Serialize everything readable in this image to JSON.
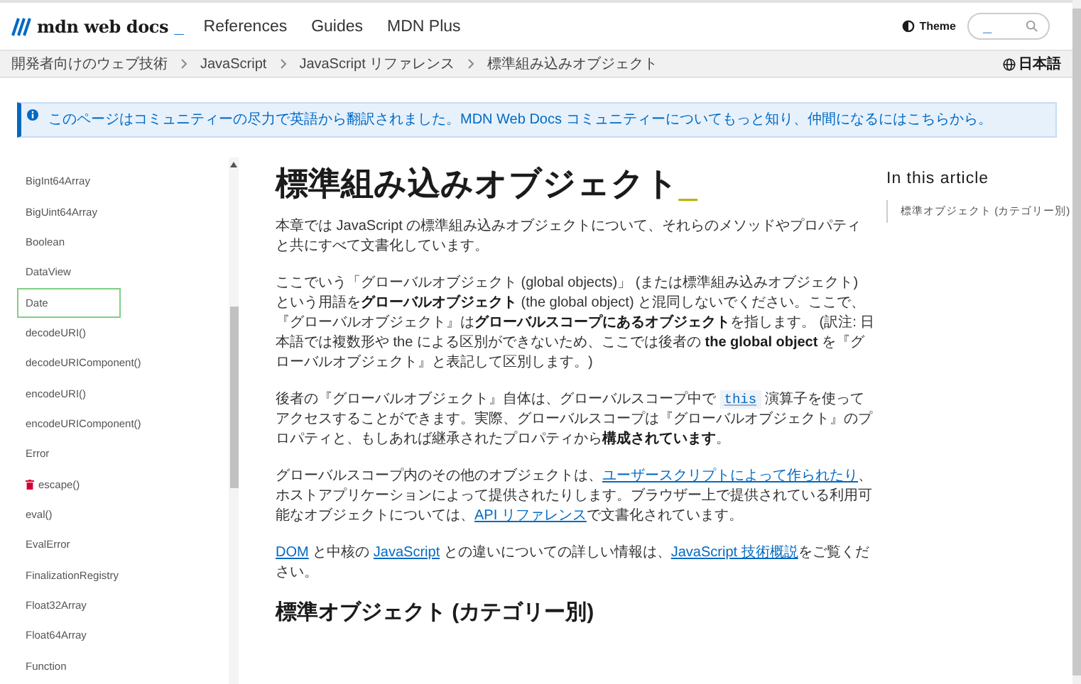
{
  "header": {
    "logo": {
      "text": "mdn web docs",
      "cursor": "_"
    },
    "nav": [
      "References",
      "Guides",
      "MDN Plus"
    ],
    "theme_button": "Theme",
    "search": {
      "placeholder": "_"
    }
  },
  "breadcrumbs": [
    "開発者向けのウェブ技術",
    "JavaScript",
    "JavaScript リファレンス",
    "標準組み込みオブジェクト"
  ],
  "language": "日本語",
  "notice": "このページはコミュニティーの尽力で英語から翻訳されました。MDN Web Docs コミュニティーについてもっと知り、仲間になるにはこちらから。",
  "sidebar": {
    "items": [
      {
        "label": "BigInt64Array",
        "selected": false,
        "deprecated": false
      },
      {
        "label": "BigUint64Array",
        "selected": false,
        "deprecated": false
      },
      {
        "label": "Boolean",
        "selected": false,
        "deprecated": false
      },
      {
        "label": "DataView",
        "selected": false,
        "deprecated": false
      },
      {
        "label": "Date",
        "selected": true,
        "deprecated": false
      },
      {
        "label": "decodeURI()",
        "selected": false,
        "deprecated": false
      },
      {
        "label": "decodeURIComponent()",
        "selected": false,
        "deprecated": false
      },
      {
        "label": "encodeURI()",
        "selected": false,
        "deprecated": false
      },
      {
        "label": "encodeURIComponent()",
        "selected": false,
        "deprecated": false
      },
      {
        "label": "Error",
        "selected": false,
        "deprecated": false
      },
      {
        "label": "escape()",
        "selected": false,
        "deprecated": true
      },
      {
        "label": "eval()",
        "selected": false,
        "deprecated": false
      },
      {
        "label": "EvalError",
        "selected": false,
        "deprecated": false
      },
      {
        "label": "FinalizationRegistry",
        "selected": false,
        "deprecated": false
      },
      {
        "label": "Float32Array",
        "selected": false,
        "deprecated": false
      },
      {
        "label": "Float64Array",
        "selected": false,
        "deprecated": false
      },
      {
        "label": "Function",
        "selected": false,
        "deprecated": false
      }
    ]
  },
  "article": {
    "title": "標準組み込みオブジェクト",
    "title_cursor": "_",
    "paragraphs": [
      [
        {
          "kind": "text",
          "text": "本章では JavaScript の標準組み込みオブジェクトについて、それらのメソッドやプロパティと共にすべて文書化しています。"
        }
      ],
      [
        {
          "kind": "text",
          "text": "ここでいう「グローバルオブジェクト (global objects)」 (または標準組み込みオブジェクト) という用語を**グローバルオブジェクト** (the global object) と混同しないでください。ここで、『グローバルオブジェクト』は**グローバルスコープにあるオブジェクト**を指します。 (訳注: 日本語では複数形や the による区別ができないため、ここでは後者の **the global object** を『グローバルオブジェクト』と表記して区別します。)"
        }
      ],
      [
        {
          "kind": "text",
          "text": "後者の『グローバルオブジェクト』自体は、グローバルスコープ中で "
        },
        {
          "kind": "code",
          "text": "this"
        },
        {
          "kind": "text",
          "text": " 演算子を使ってアクセスすることができます。実際、グローバルスコープは『グローバルオブジェクト』のプロパティと、もしあれば継承されたプロパティから**構成されています**。"
        }
      ],
      [
        {
          "kind": "text",
          "text": "グローバルスコープ内のその他のオブジェクトは、"
        },
        {
          "kind": "link",
          "text": "ユーザースクリプトによって作られたり"
        },
        {
          "kind": "text",
          "text": "、ホストアプリケーションによって提供されたりします。ブラウザー上で提供されている利用可能なオブジェクトについては、"
        },
        {
          "kind": "link",
          "text": "API リファレンス"
        },
        {
          "kind": "text",
          "text": "で文書化されています。"
        }
      ],
      [
        {
          "kind": "link",
          "text": "DOM"
        },
        {
          "kind": "text",
          "text": " と中核の "
        },
        {
          "kind": "link",
          "text": "JavaScript"
        },
        {
          "kind": "text",
          "text": " との違いについての詳しい情報は、"
        },
        {
          "kind": "link",
          "text": "JavaScript 技術概説"
        },
        {
          "kind": "text",
          "text": "をご覧ください。"
        }
      ]
    ],
    "next_heading": "標準オブジェクト (カテゴリー別)"
  },
  "toc": {
    "title": "In this article",
    "items": [
      "標準オブジェクト (カテゴリー別)"
    ]
  }
}
